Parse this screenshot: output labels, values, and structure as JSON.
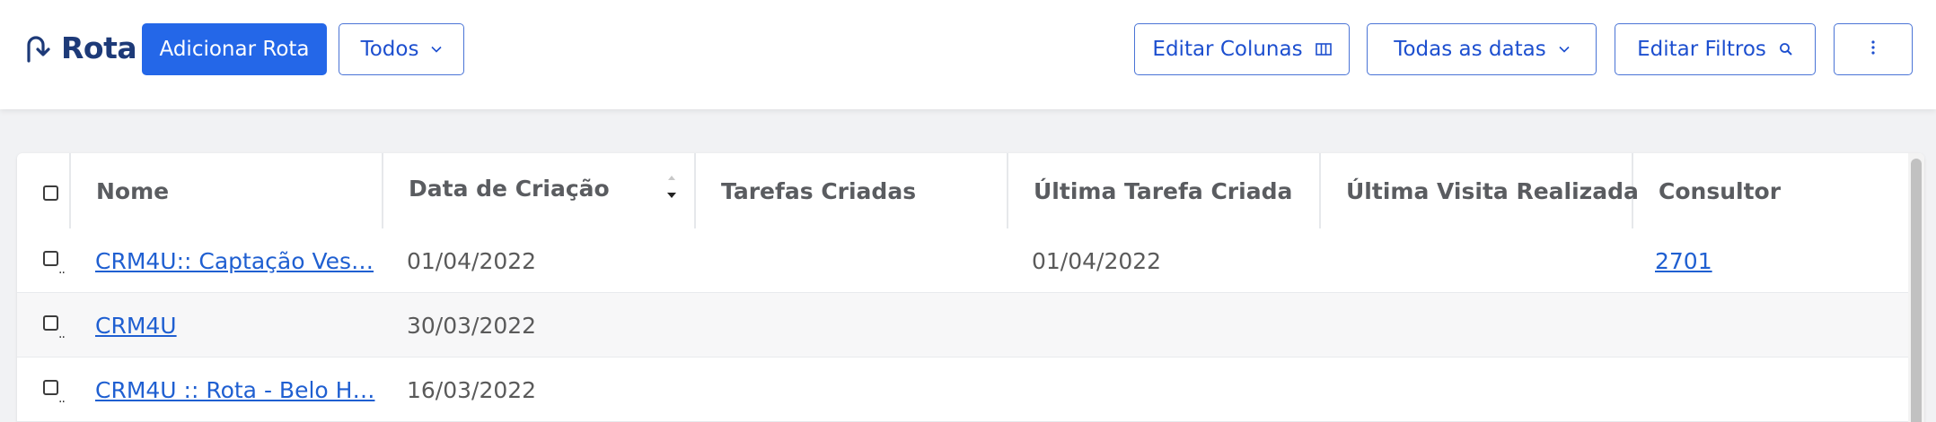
{
  "header": {
    "title": "Rota",
    "add_button": "Adicionar Rota",
    "filter_select": "Todos",
    "edit_columns": "Editar Colunas",
    "date_range": "Todas as datas",
    "edit_filters": "Editar Filtros",
    "more_icon": "kebab-menu-icon"
  },
  "colors": {
    "primary": "#2467e8",
    "title": "#1d3a78",
    "link": "#1f5fd1"
  },
  "table": {
    "columns": [
      "Nome",
      "Data de Criação",
      "Tarefas Criadas",
      "Última Tarefa Criada",
      "Última Visita Realizada",
      "Consultor"
    ],
    "sorted_column": "Data de Criação",
    "rows": [
      {
        "nome": "CRM4U:: Captação Ves…",
        "data_criacao": "01/04/2022",
        "tarefas_criadas": "",
        "ultima_tarefa": "01/04/2022",
        "ultima_visita": "",
        "consultor": "2701"
      },
      {
        "nome": "CRM4U",
        "data_criacao": "30/03/2022",
        "tarefas_criadas": "",
        "ultima_tarefa": "",
        "ultima_visita": "",
        "consultor": ""
      },
      {
        "nome": "CRM4U :: Rota - Belo H…",
        "data_criacao": "16/03/2022",
        "tarefas_criadas": "",
        "ultima_tarefa": "",
        "ultima_visita": "",
        "consultor": ""
      }
    ]
  }
}
